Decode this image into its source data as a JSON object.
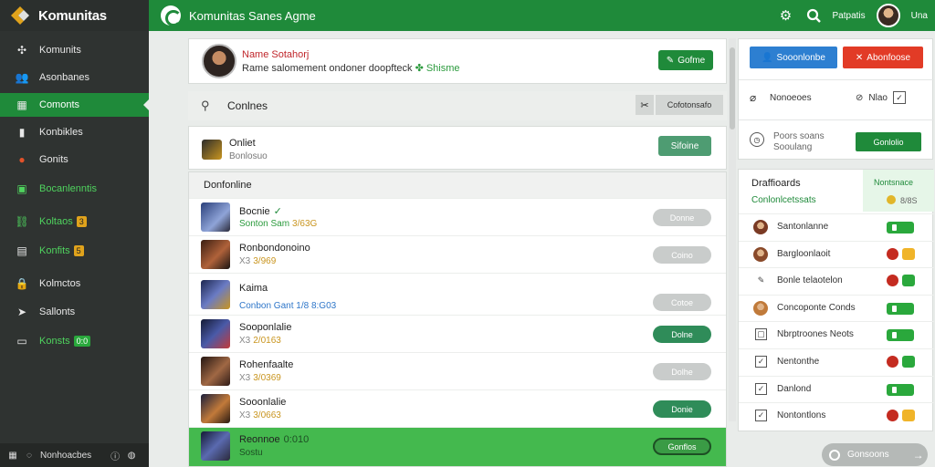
{
  "app": {
    "brand": "Komunitas",
    "title": "Komunitas Sanes Agme",
    "user_label": "Patpatis",
    "user_name": "Una"
  },
  "colors": {
    "primary_green": "#1f8a3a",
    "sidebar_dark": "#2f3331",
    "blue": "#2d7fd1",
    "red": "#e23b26"
  },
  "sidebar": {
    "items": [
      {
        "label": "Komunits",
        "icon": "puzzle-icon"
      },
      {
        "label": "Asonbanes",
        "icon": "people-icon"
      },
      {
        "label": "Comonts",
        "icon": "grid-icon",
        "active": true
      },
      {
        "label": "Konbikles",
        "icon": "book-icon"
      },
      {
        "label": "Gonits",
        "icon": "badge-icon"
      },
      {
        "label": "Bocanlenntis",
        "icon": "calendar-icon"
      },
      {
        "label": "Koltaos",
        "tag": "3",
        "icon": "link-icon"
      },
      {
        "label": "Konfits",
        "tag": "5",
        "icon": "calculator-icon"
      },
      {
        "label": "Kolmctos",
        "icon": "lock-icon"
      },
      {
        "label": "Sallonts",
        "icon": "send-icon"
      },
      {
        "label": "Konsts",
        "tag": "0:0",
        "icon": "twitch-icon"
      }
    ],
    "status": {
      "label": "Nonhoacbes"
    }
  },
  "profile": {
    "name": "Name Sotahorj",
    "desc": "Rame salomement ondoner doopfteck",
    "desc_tail": "Shisme",
    "button": "Gofme"
  },
  "section": {
    "title": "Conlnes",
    "button": "Cofotonsafo"
  },
  "online": {
    "title": "Onliet",
    "sub": "Bonlosuo",
    "button": "Sifoine"
  },
  "list": {
    "header": "Donfonline",
    "rows": [
      {
        "name": "Bocnie",
        "em": "✓",
        "sub": "Sonton Sam",
        "gold": "3/63G",
        "btn": "Donne",
        "btn_style": "grey"
      },
      {
        "name": "Ronbondonoino",
        "sub": "X3",
        "gold": "3/969",
        "btn": "Coino",
        "btn_style": "grey"
      },
      {
        "name": "Kaima",
        "sub": "Conbon Gant 1/8 8:G03",
        "btn": "Cotoe",
        "btn_style": "grey",
        "sub_style": "blue"
      },
      {
        "name": "Sooponlalie",
        "sub": "X3",
        "gold": "2/0163",
        "btn": "Dolne",
        "btn_style": "green"
      },
      {
        "name": "Rohenfaalte",
        "sub": "X3",
        "gold": "3/0369",
        "btn": "Dolhe",
        "btn_style": "grey"
      },
      {
        "name": "Sooonlalie",
        "sub": "X3",
        "gold": "3/0663",
        "btn": "Donie",
        "btn_style": "green"
      },
      {
        "name": "Reonnoe",
        "em": "0:010",
        "sub": "Sostu",
        "btn": "Gonflos",
        "btn_style": "highlight"
      }
    ]
  },
  "right": {
    "btn_blue": "Sooonlonbe",
    "btn_red": "Abonfoose",
    "nomad": "Nonoeoes",
    "misc": "Nlao",
    "status_line1": "Poors soans",
    "status_line2": "Sooulang",
    "status_btn": "Gonlolio",
    "list_title": "Draffioards",
    "list_sub": "Conlonlcetssats",
    "list_right_a": "Nontsnace",
    "list_right_b": "8/8S",
    "friends": [
      {
        "name": "Santonlanne",
        "ctrl": "toggle",
        "mark": "avatar",
        "fill": "#7a3a24"
      },
      {
        "name": "Bargloonlaoit",
        "ctrl": "dots-yellow",
        "mark": "avatar",
        "fill": "#8a4a2a"
      },
      {
        "name": "Bonle telaotelon",
        "ctrl": "dots-green",
        "mark": "pen"
      },
      {
        "name": "Concoponte Conds",
        "ctrl": "toggle",
        "mark": "avatar",
        "fill": "#c07a3a"
      },
      {
        "name": "Nbrptroones Neots",
        "ctrl": "toggle",
        "mark": "box",
        "glyph": "▢"
      },
      {
        "name": "Nentonthe",
        "ctrl": "dots-green",
        "mark": "box",
        "glyph": "✓"
      },
      {
        "name": "Danlond",
        "ctrl": "toggle",
        "mark": "box",
        "glyph": "✓"
      },
      {
        "name": "Nontontlons",
        "ctrl": "dots-yellow",
        "mark": "box",
        "glyph": "✓"
      }
    ],
    "bottom_label": "Gonsoons"
  }
}
